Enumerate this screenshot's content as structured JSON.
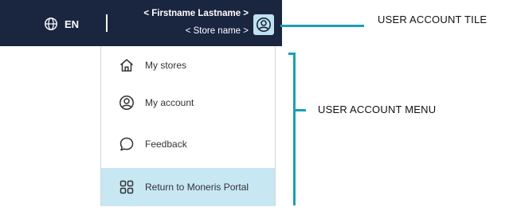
{
  "header": {
    "language_label": "EN",
    "user_name": "< Firstname Lastname >",
    "store_name": "< Store name >"
  },
  "menu": {
    "items": [
      {
        "label": "My stores",
        "icon": "home-icon"
      },
      {
        "label": "My account",
        "icon": "user-circle-icon"
      },
      {
        "label": "Feedback",
        "icon": "speech-bubble-icon"
      },
      {
        "label": "Return to Moneris Portal",
        "icon": "grid-icon"
      }
    ]
  },
  "callouts": {
    "tile_label": "USER ACCOUNT TILE",
    "menu_label": "USER ACCOUNT MENU"
  },
  "colors": {
    "topbar": "#1a2540",
    "accent": "#1aa0b4",
    "highlight": "#c7e7f3"
  }
}
